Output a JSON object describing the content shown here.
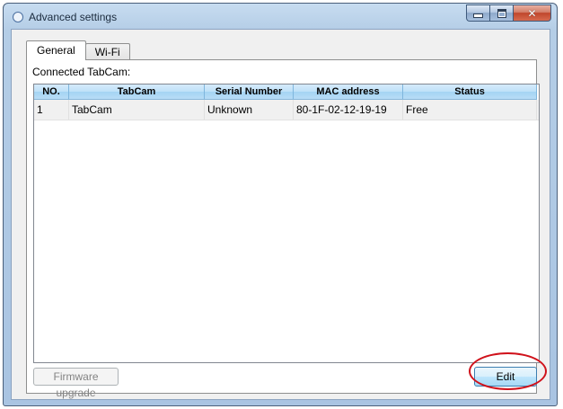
{
  "window": {
    "title": "Advanced settings",
    "icon": "app-ring-icon",
    "controls": {
      "minimize": "minimize-icon",
      "maximize": "maximize-icon",
      "close": "close-icon",
      "close_glyph": "✕"
    }
  },
  "tabs": [
    {
      "label": "General",
      "active": true
    },
    {
      "label": "Wi-Fi",
      "active": false
    }
  ],
  "general": {
    "connected_label": "Connected TabCam:",
    "table": {
      "columns": [
        "NO.",
        "TabCam",
        "Serial Number",
        "MAC address",
        "Status"
      ],
      "rows": [
        [
          "1",
          "TabCam",
          "Unknown",
          "80-1F-02-12-19-19",
          "Free"
        ]
      ]
    },
    "firmware_button": "Firmware upgrade",
    "edit_button": "Edit"
  },
  "colors": {
    "header_blue": "#bfe1f8",
    "annotation_red": "#d0121b"
  }
}
